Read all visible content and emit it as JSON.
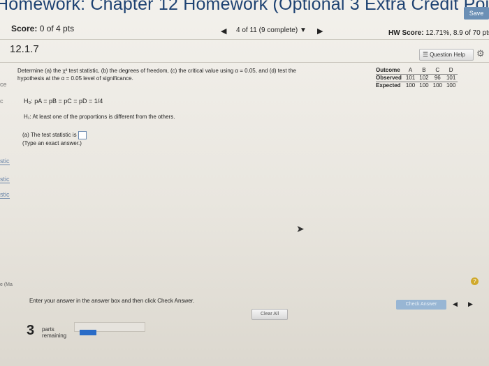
{
  "header": {
    "title": "Homework: Chapter 12 Homework (Optional 3 Extra Credit Point",
    "save_label": "Save"
  },
  "score_bar": {
    "score_label": "Score:",
    "score_value": "0 of 4 pts",
    "pager": "4 of 11 (9 complete) ▼",
    "hw_label": "HW Score:",
    "hw_value": "12.71%, 8.9 of 70 pts"
  },
  "question": {
    "number": "12.1.7",
    "help_label": "Question Help",
    "prompt_line1": "Determine (a) the χ² test statistic, (b) the degrees of freedom, (c) the critical value using α = 0.05, and (d) test the",
    "prompt_line2": "hypothesis at the α = 0.05 level of significance.",
    "h0": "H₀: pA = pB = pC = pD = 1/4",
    "h1": "H₁: At least one of the proportions is different from the others.",
    "part_a_line1": "(a) The test statistic is",
    "part_a_line2": "(Type an exact answer.)"
  },
  "table": {
    "header": [
      "Outcome",
      "A",
      "B",
      "C",
      "D"
    ],
    "rows": [
      [
        "Observed",
        "101",
        "102",
        "96",
        "101"
      ],
      [
        "Expected",
        "100",
        "100",
        "100",
        "100"
      ]
    ]
  },
  "footer": {
    "instructions": "Enter your answer in the answer box and then click Check Answer.",
    "clear_label": "Clear All",
    "check_label": "Check Answer",
    "parts_count": "3",
    "parts_text_1": "parts",
    "parts_text_2": "remaining",
    "help_glyph": "?"
  },
  "sidebar_fragments": [
    "ce",
    "c",
    "",
    "stic",
    "stic",
    "stic",
    "e (Ma"
  ],
  "colors": {
    "title": "#1e4272",
    "accent": "#2a6cc7",
    "check_button": "#98b6d4",
    "help_circle": "#d0a92c"
  },
  "icons": {
    "help": "list-icon",
    "settings": "gear-icon",
    "prev": "triangle-left-icon",
    "next": "triangle-right-icon",
    "pointer": "cursor-icon"
  }
}
